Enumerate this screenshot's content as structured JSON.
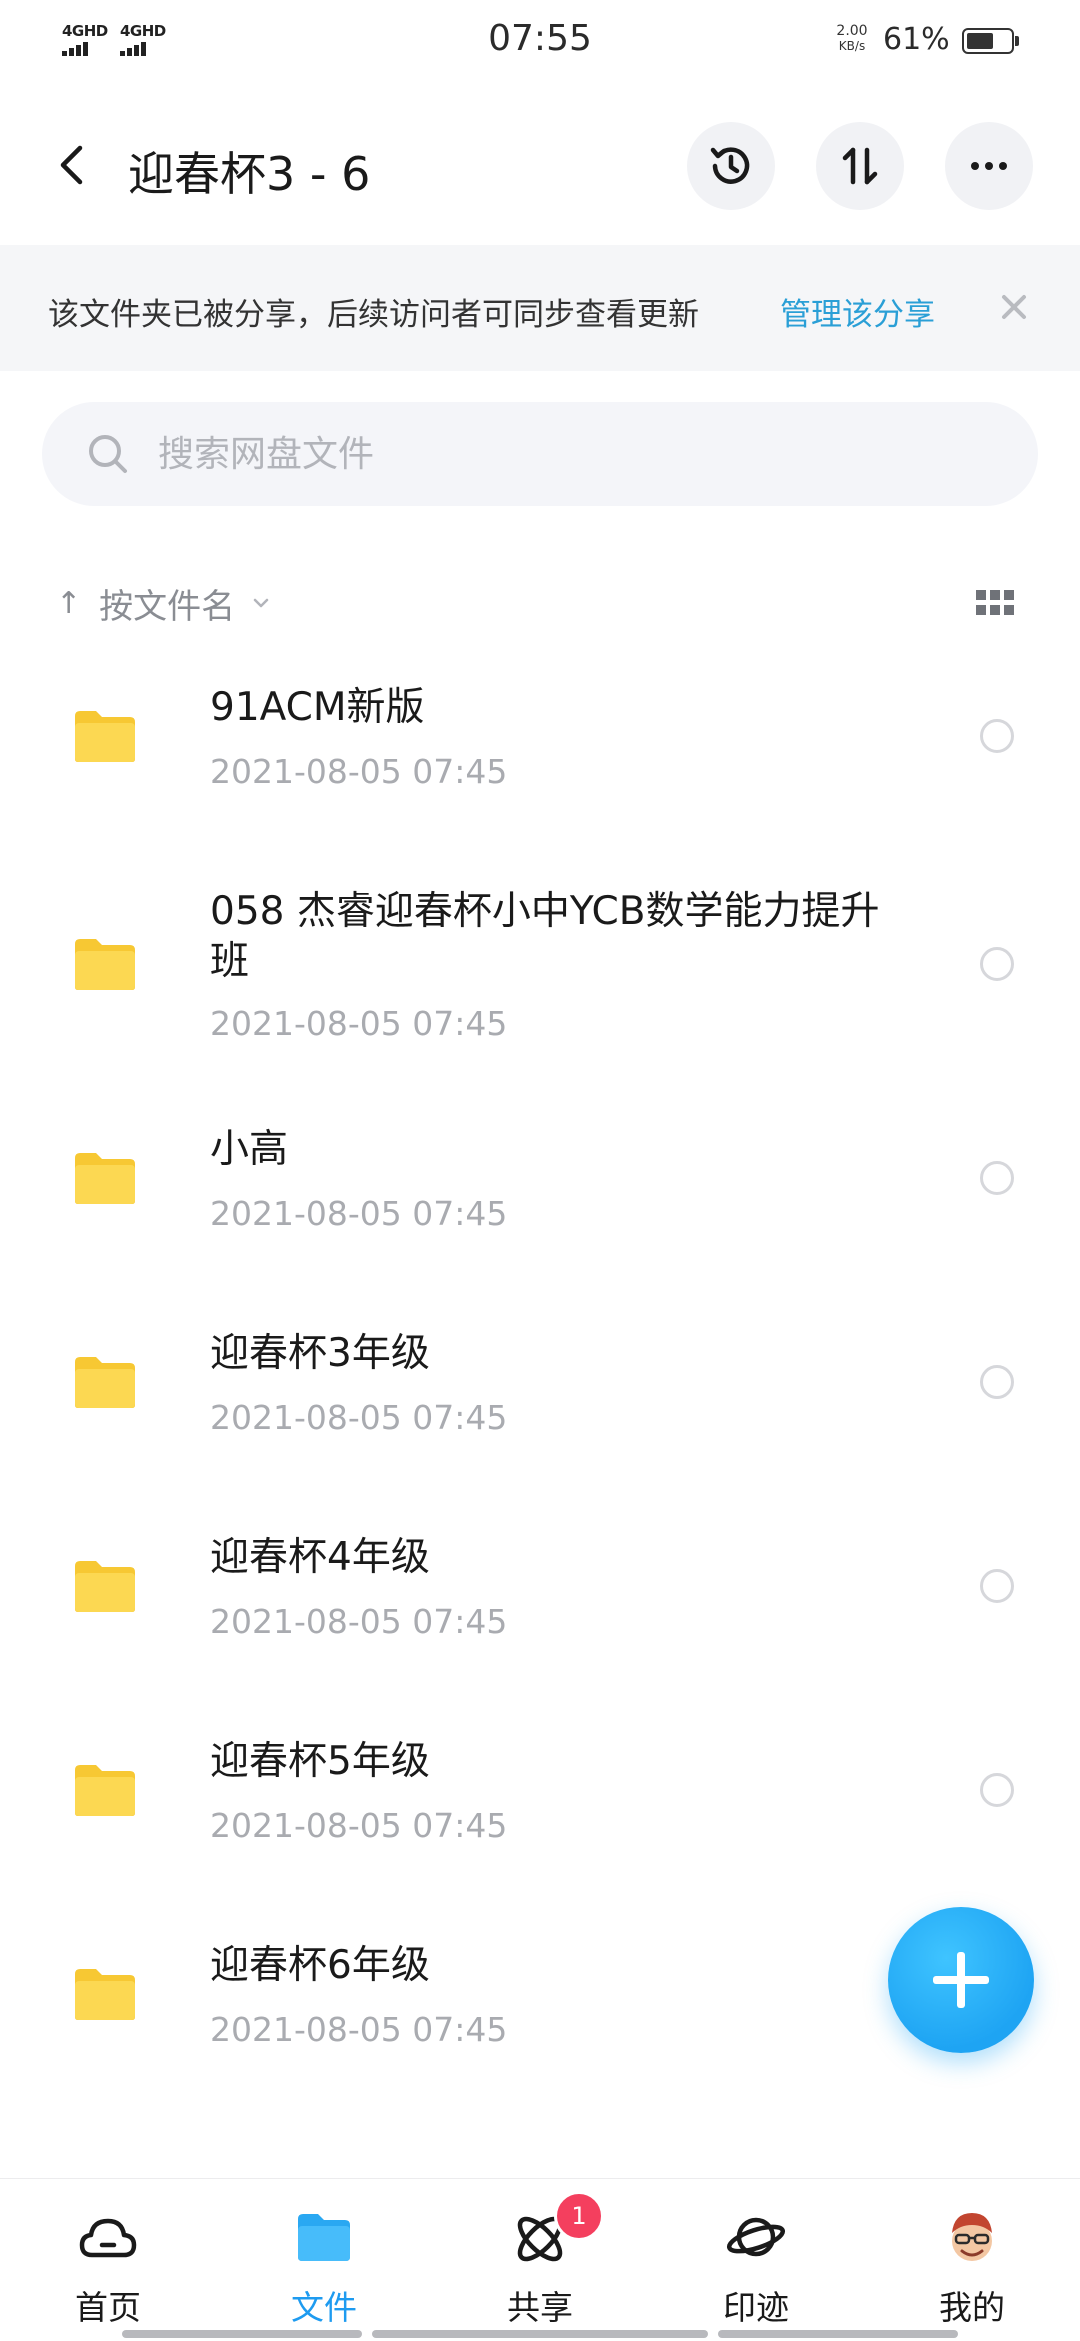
{
  "status_bar": {
    "signal1": "4GHD",
    "signal2": "4GHD",
    "time": "07:55",
    "net_speed_value": "2.00",
    "net_speed_unit": "KB/s",
    "battery_text": "61%",
    "battery_level": 0.61
  },
  "header": {
    "title": "迎春杯3 - 6",
    "icons": [
      "back-icon",
      "history-icon",
      "sort-transfer-icon",
      "more-icon"
    ]
  },
  "banner": {
    "text": "该文件夹已被分享，后续访问者可同步查看更新",
    "link": "管理该分享"
  },
  "search": {
    "placeholder": "搜索网盘文件"
  },
  "sort": {
    "label": "按文件名"
  },
  "files": [
    {
      "name": "91ACM新版",
      "date": "2021-08-05  07:45"
    },
    {
      "name": "058 杰睿迎春杯小中YCB数学能力提升班",
      "date": "2021-08-05  07:45"
    },
    {
      "name": "小高",
      "date": "2021-08-05  07:45"
    },
    {
      "name": "迎春杯3年级",
      "date": "2021-08-05  07:45"
    },
    {
      "name": "迎春杯4年级",
      "date": "2021-08-05  07:45"
    },
    {
      "name": "迎春杯5年级",
      "date": "2021-08-05  07:45"
    },
    {
      "name": "迎春杯6年级",
      "date": "2021-08-05  07:45"
    }
  ],
  "bottom_nav": {
    "items": [
      {
        "label": "首页",
        "icon": "cloud-home-icon",
        "active": false
      },
      {
        "label": "文件",
        "icon": "folder-icon",
        "active": true
      },
      {
        "label": "共享",
        "icon": "atom-share-icon",
        "active": false,
        "badge": "1"
      },
      {
        "label": "印迹",
        "icon": "planet-icon",
        "active": false
      },
      {
        "label": "我的",
        "icon": "avatar-icon",
        "active": false
      }
    ]
  },
  "colors": {
    "accent": "#1e9bf0",
    "link": "#2a9fd6",
    "folder": "#fcd54a",
    "badge": "#f43f5e"
  }
}
